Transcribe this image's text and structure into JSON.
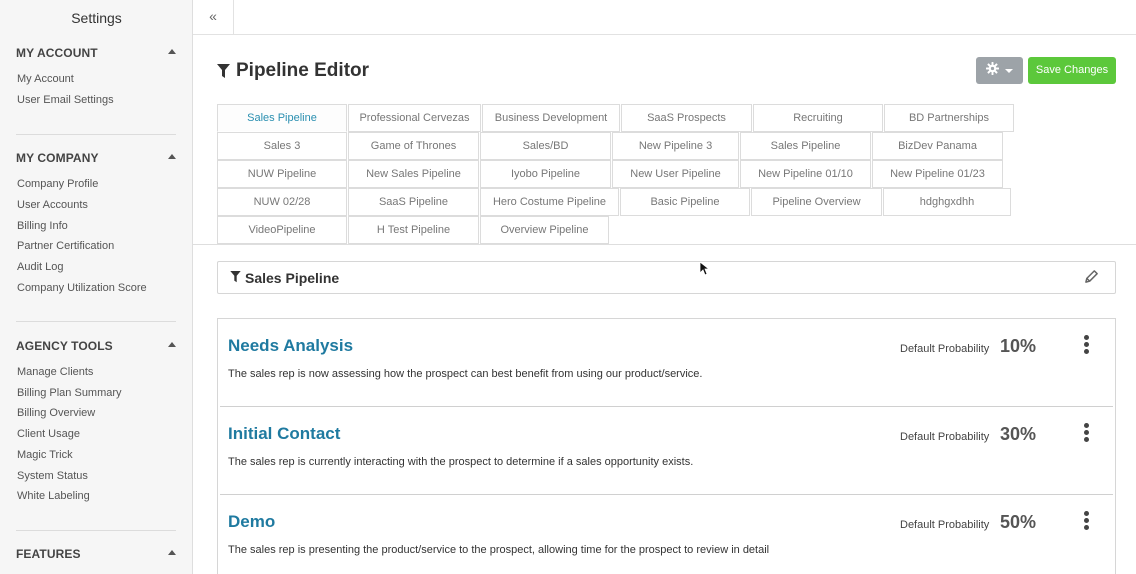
{
  "sidebar": {
    "title": "Settings",
    "sections": [
      {
        "heading": "MY ACCOUNT",
        "items": [
          "My Account",
          "User Email Settings"
        ]
      },
      {
        "heading": "MY COMPANY",
        "items": [
          "Company Profile",
          "User Accounts",
          "Billing Info",
          "Partner Certification",
          "Audit Log",
          "Company Utilization Score"
        ]
      },
      {
        "heading": "AGENCY TOOLS",
        "items": [
          "Manage Clients",
          "Billing Plan Summary",
          "Billing Overview",
          "Client Usage",
          "Magic Trick",
          "System Status",
          "White Labeling"
        ]
      },
      {
        "heading": "FEATURES",
        "items": []
      }
    ]
  },
  "topbar": {
    "collapse_glyph": "«"
  },
  "header": {
    "title": "Pipeline Editor",
    "save_label": "Save Changes"
  },
  "tabs": [
    [
      "Sales Pipeline",
      "Professional Cervezas",
      "Business Development",
      "SaaS Prospects",
      "Recruiting",
      "BD Partnerships"
    ],
    [
      "Sales 3",
      "Game of Thrones",
      "Sales/BD",
      "New Pipeline 3",
      "Sales Pipeline",
      "BizDev Panama"
    ],
    [
      "NUW Pipeline",
      "New Sales Pipeline",
      "Iyobo Pipeline",
      "New User Pipeline",
      "New Pipeline 01/10",
      "New Pipeline 01/23"
    ],
    [
      "NUW 02/28",
      "SaaS Pipeline",
      "Hero Costume Pipeline",
      "Basic Pipeline",
      "Pipeline Overview",
      "hdghgxdhh"
    ],
    [
      "VideoPipeline",
      "H Test Pipeline",
      "Overview Pipeline"
    ]
  ],
  "active_tab": "Sales Pipeline",
  "pipeline": {
    "name": "Sales Pipeline",
    "stages": [
      {
        "name": "Needs Analysis",
        "description": "The sales rep is now assessing how the prospect can best benefit from using our product/service.",
        "prob_label": "Default Probability",
        "prob": "10%"
      },
      {
        "name": "Initial Contact",
        "description": "The sales rep is currently interacting with the prospect to determine if a sales opportunity exists.",
        "prob_label": "Default Probability",
        "prob": "30%"
      },
      {
        "name": "Demo",
        "description": "The sales rep is presenting the product/service to the prospect, allowing time for the prospect to review in detail",
        "prob_label": "Default Probability",
        "prob": "50%"
      }
    ]
  },
  "colors": {
    "accent": "#1f7aa0",
    "active_tab": "#2a8fb0",
    "save_button": "#5cc83b",
    "gear_button": "#9da3a8"
  },
  "icons": [
    "filter-icon",
    "gear-icon",
    "chevron-down-icon",
    "pencil-icon",
    "kebab-icon",
    "cursor-icon",
    "double-chevron-left-icon"
  ]
}
